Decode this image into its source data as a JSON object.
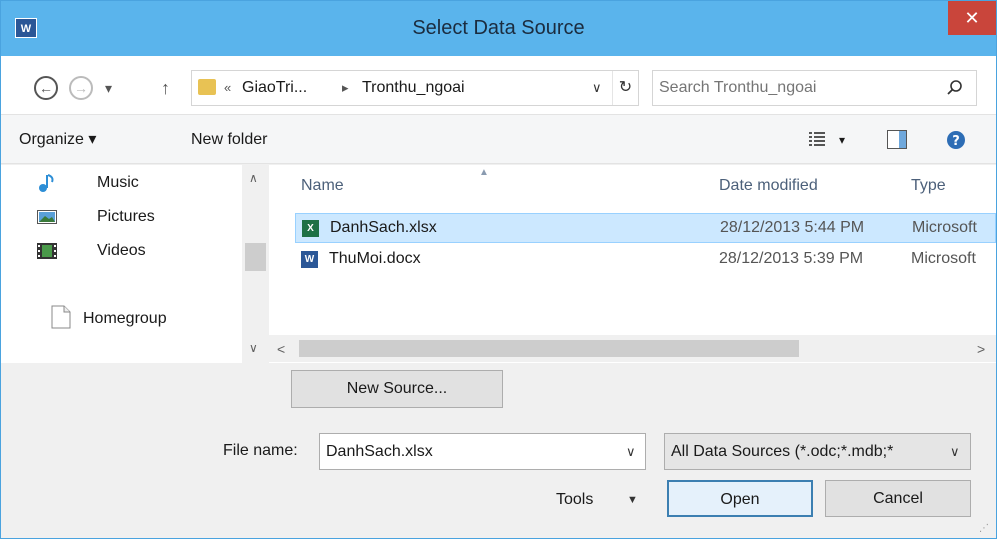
{
  "window": {
    "title": "Select Data Source",
    "app_badge": "W",
    "close_glyph": "✕"
  },
  "nav": {
    "back_glyph": "←",
    "forward_glyph": "→",
    "recent_glyph": "▾",
    "up_glyph": "↑",
    "breadcrumb": {
      "overflow": "«",
      "items": [
        "GiaoTri...",
        "Tronthu_ngoai"
      ],
      "sep": "▸"
    },
    "dropdown_glyph": "∨",
    "refresh_glyph": "↻",
    "search_placeholder": "Search Tronthu_ngoai"
  },
  "toolbar": {
    "organize_label": "Organize ▾",
    "new_folder_label": "New folder",
    "view_dd_glyph": "▾"
  },
  "sidebar": {
    "items": [
      {
        "label": "Music",
        "icon": "music-icon"
      },
      {
        "label": "Pictures",
        "icon": "pictures-icon"
      },
      {
        "label": "Videos",
        "icon": "videos-icon"
      },
      {
        "label": "Homegroup",
        "icon": "homegroup-icon"
      }
    ],
    "scroll_up": "∧",
    "scroll_down": "∨"
  },
  "filelist": {
    "columns": [
      "Name",
      "Date modified",
      "Type"
    ],
    "sort_glyph": "▲",
    "rows": [
      {
        "name": "DanhSach.xlsx",
        "date": "28/12/2013 5:44 PM",
        "type": "Microsoft",
        "icon": "excel-file-icon",
        "badge": "X",
        "color": "#1e7145",
        "selected": true
      },
      {
        "name": "ThuMoi.docx",
        "date": "28/12/2013 5:39 PM",
        "type": "Microsoft",
        "icon": "word-file-icon",
        "badge": "W",
        "color": "#2b5797",
        "selected": false
      }
    ],
    "scroll_left": "<",
    "scroll_right": ">"
  },
  "bottom": {
    "new_source_label": "New Source...",
    "file_name_label": "File name:",
    "file_name_value": "DanhSach.xlsx",
    "filter_value": "All Data Sources (*.odc;*.mdb;*",
    "combo_dd_glyph": "∨",
    "tools_label": "Tools",
    "tools_dd_glyph": "▼",
    "open_label": "Open",
    "cancel_label": "Cancel",
    "grip_glyph": "⋰"
  }
}
